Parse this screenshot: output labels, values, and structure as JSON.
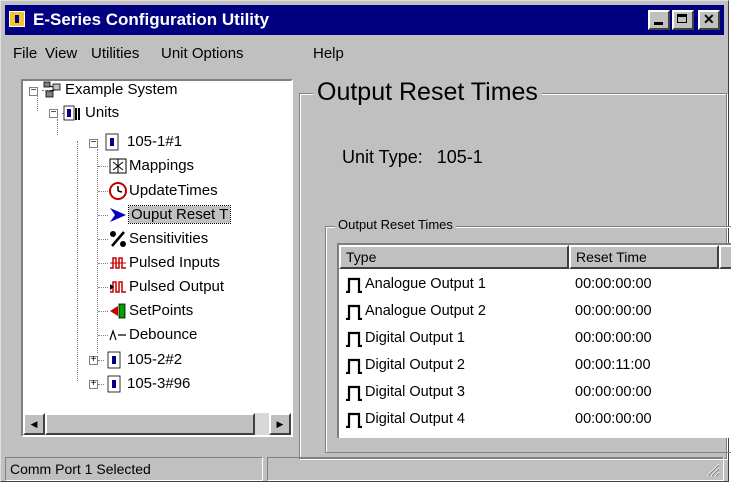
{
  "window": {
    "title": "E-Series Configuration Utility"
  },
  "menu": [
    "File",
    "View",
    "Utilities",
    "Unit Options",
    "Help"
  ],
  "tree": {
    "root": "Example System",
    "units_label": "Units",
    "unit1": "105-1#1",
    "children": [
      {
        "label": "Mappings",
        "icon": "mappings-icon"
      },
      {
        "label": "UpdateTimes",
        "icon": "clock-icon"
      },
      {
        "label": "Ouput Reset T",
        "icon": "arrow-right-icon"
      },
      {
        "label": "Sensitivities",
        "icon": "percent-icon"
      },
      {
        "label": "Pulsed Inputs",
        "icon": "pulsed-inputs-icon"
      },
      {
        "label": "Pulsed Output",
        "icon": "pulsed-output-icon"
      },
      {
        "label": "SetPoints",
        "icon": "setpoints-icon"
      },
      {
        "label": "Debounce",
        "icon": "debounce-icon"
      }
    ],
    "unit2": "105-2#2",
    "unit3": "105-3#96"
  },
  "panel": {
    "title": "Output Reset Times",
    "unit_type_label": "Unit Type:",
    "unit_type_value": "105-1",
    "group_title": "Output Reset Times",
    "columns": [
      "Type",
      "Reset Time"
    ],
    "rows": [
      {
        "type": "Analogue Output 1",
        "time": "00:00:00:00"
      },
      {
        "type": "Analogue Output 2",
        "time": "00:00:00:00"
      },
      {
        "type": "Digital Output 1",
        "time": "00:00:00:00"
      },
      {
        "type": "Digital Output 2",
        "time": "00:00:11:00"
      },
      {
        "type": "Digital Output 3",
        "time": "00:00:00:00"
      },
      {
        "type": "Digital Output 4",
        "time": "00:00:00:00"
      }
    ]
  },
  "status": {
    "message": "Comm Port 1 Selected"
  },
  "colors": {
    "titlebar": "#000080",
    "face": "#c0c0c0",
    "selection_arrow": "#0000c0"
  }
}
